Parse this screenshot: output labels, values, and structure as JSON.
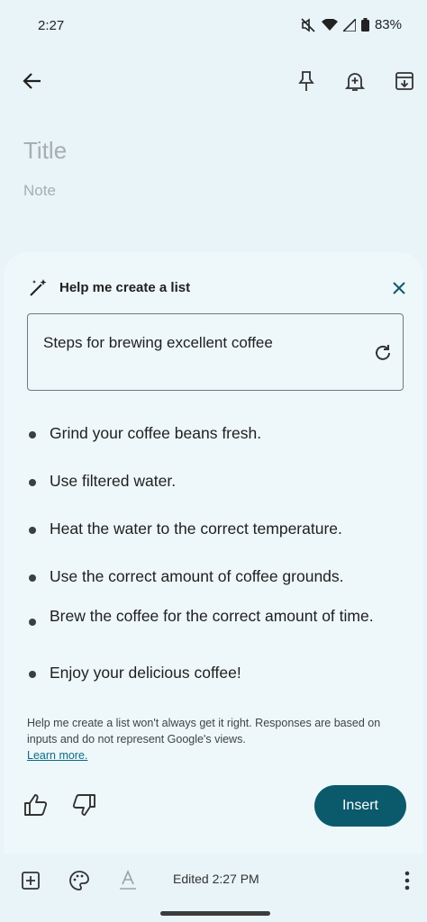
{
  "status_bar": {
    "time": "2:27",
    "battery": "83%"
  },
  "note": {
    "title_placeholder": "Title",
    "body_placeholder": "Note"
  },
  "assistant": {
    "title": "Help me create a list",
    "prompt": "Steps for brewing excellent coffee",
    "items": [
      "Grind your coffee beans fresh.",
      "Use filtered water.",
      "Heat the water to the correct temperature.",
      "Use the correct amount of coffee grounds.",
      "Brew the coffee for the correct amount of time.",
      "Enjoy your delicious coffee!"
    ],
    "disclaimer": "Help me create a list won't always get it right. Responses are based on inputs and do not represent Google's views.",
    "learn_more": "Learn more.",
    "insert_label": "Insert"
  },
  "bottom_bar": {
    "edited": "Edited 2:27 PM"
  },
  "icons": {
    "back": "arrow-left-icon",
    "pin": "pin-icon",
    "reminder": "bell-plus-icon",
    "archive": "archive-icon",
    "sparkle": "magic-wand-icon",
    "close": "close-icon",
    "refresh": "refresh-icon",
    "like": "thumbs-up-icon",
    "dislike": "thumbs-down-icon",
    "add": "add-box-icon",
    "palette": "palette-icon",
    "format": "text-format-icon",
    "more": "more-vert-icon"
  },
  "colors": {
    "accent": "#0a5a6c",
    "background": "#e8f4f8",
    "sheet": "#eef7fa"
  }
}
